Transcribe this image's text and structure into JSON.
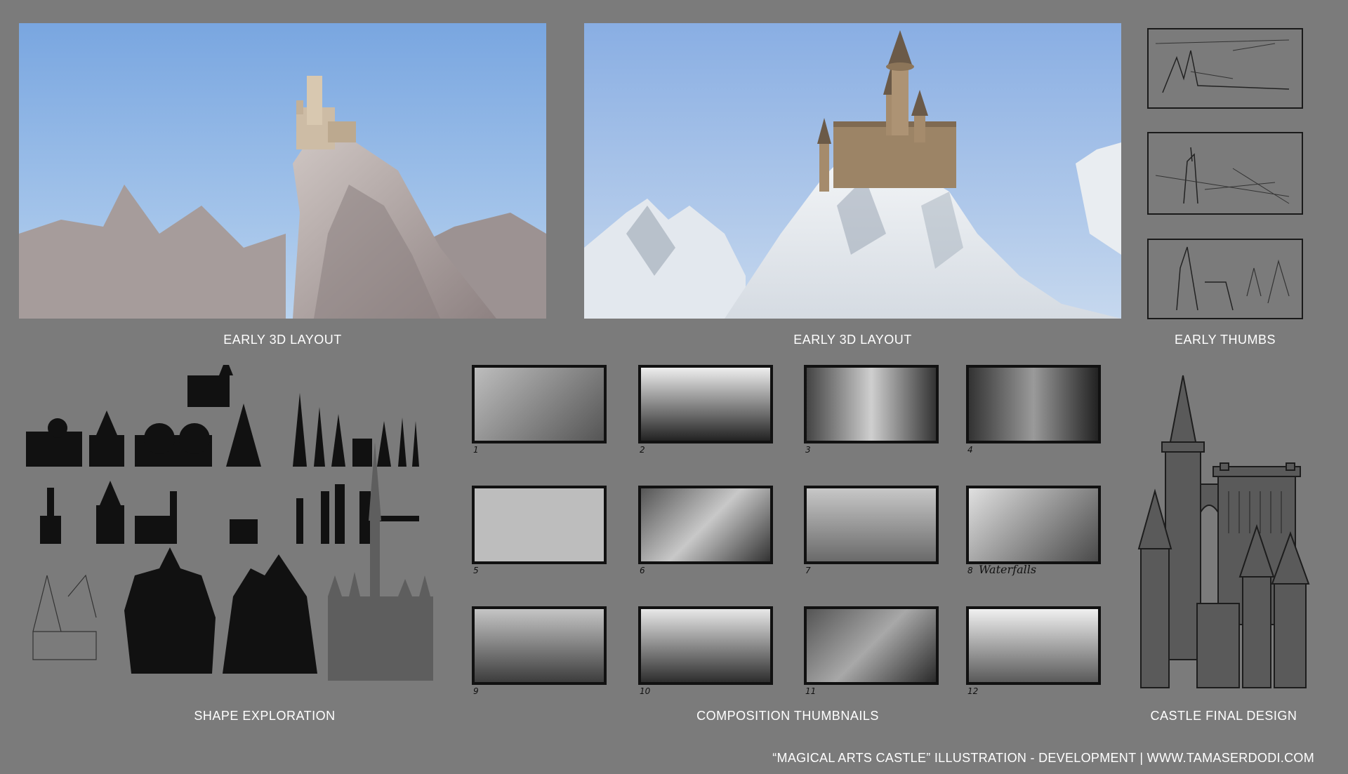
{
  "captions": {
    "layout_left": "EARLY 3D LAYOUT",
    "layout_right": "EARLY 3D LAYOUT",
    "early_thumbs": "EARLY THUMBS",
    "shape_exploration": "SHAPE EXPLORATION",
    "composition_thumbnails": "COMPOSITION THUMBNAILS",
    "castle_final_design": "CASTLE FINAL DESIGN"
  },
  "thumbnails": [
    {
      "number": "1"
    },
    {
      "number": "2"
    },
    {
      "number": "3"
    },
    {
      "number": "4"
    },
    {
      "number": "5"
    },
    {
      "number": "6"
    },
    {
      "number": "7"
    },
    {
      "number": "8",
      "note": "Waterfalls"
    },
    {
      "number": "9"
    },
    {
      "number": "10"
    },
    {
      "number": "11"
    },
    {
      "number": "12"
    }
  ],
  "footer": "“MAGICAL ARTS CASTLE” ILLUSTRATION - DEVELOPMENT | WWW.TAMASERDODI.COM",
  "colors": {
    "background": "#7b7b7b",
    "sky": "#8fb7e6",
    "ink": "#111111"
  }
}
